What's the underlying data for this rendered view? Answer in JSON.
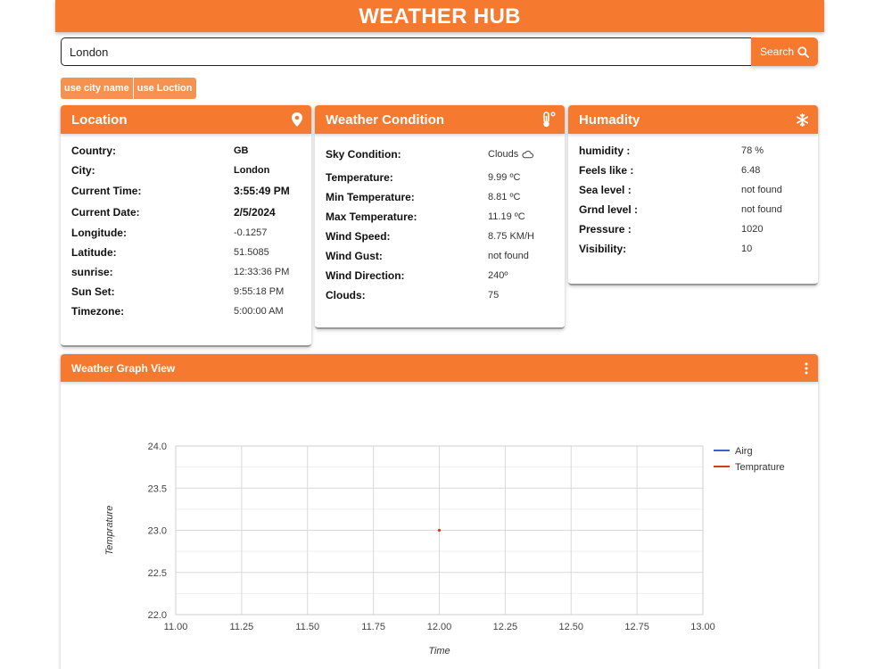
{
  "header": {
    "title": "WEATHER HUB"
  },
  "search": {
    "value": "London",
    "button_label": "Search"
  },
  "toggles": {
    "city_label": "use city name",
    "location_label": "use Loction"
  },
  "location": {
    "title": "Location",
    "rows": [
      {
        "label": "Country:",
        "value": "GB"
      },
      {
        "label": "City:",
        "value": "London"
      },
      {
        "label": "Current Time:",
        "value": "3:55:49 PM"
      },
      {
        "label": "Current Date:",
        "value": "2/5/2024"
      },
      {
        "label": "Longitude:",
        "value": "-0.1257"
      },
      {
        "label": "Latitude:",
        "value": "51.5085"
      },
      {
        "label": "sunrise:",
        "value": "12:33:36 PM"
      },
      {
        "label": "Sun Set:",
        "value": "9:55:18 PM"
      },
      {
        "label": "Timezone:",
        "value": "5:00:00 AM"
      }
    ]
  },
  "weather": {
    "title": "Weather Condition",
    "rows": [
      {
        "label": "Sky Condition:",
        "value": "Clouds"
      },
      {
        "label": "Temperature:",
        "value": "9.99 ºC"
      },
      {
        "label": "Min Temperature:",
        "value": "8.81 ºC"
      },
      {
        "label": "Max Temperature:",
        "value": "11.19 ºC"
      },
      {
        "label": "Wind Speed:",
        "value": "8.75 KM/H"
      },
      {
        "label": "Wind Gust:",
        "value": "not found"
      },
      {
        "label": "Wind Direction:",
        "value": "240º"
      },
      {
        "label": "Clouds:",
        "value": "75"
      }
    ]
  },
  "humidity": {
    "title": "Humadity",
    "rows": [
      {
        "label": "humidity :",
        "value": "78 %"
      },
      {
        "label": "Feels like :",
        "value": "6.48"
      },
      {
        "label": "Sea level :",
        "value": "not found"
      },
      {
        "label": "Grnd level :",
        "value": "not found"
      },
      {
        "label": "Pressure :",
        "value": "1020"
      },
      {
        "label": "Visibility:",
        "value": "10"
      }
    ]
  },
  "graph": {
    "title": "Weather Graph View"
  },
  "icons": {
    "search": "search-icon",
    "location": "map-pin-icon",
    "weather": "thermometer-icon",
    "humidity": "snowflake-icon",
    "sky": "cloud-icon",
    "menu": "more-vertical-icon"
  },
  "colors": {
    "accent": "#f57a30",
    "toggle": "#f5924f",
    "series_airg": "#3366cc",
    "series_temp": "#dc3912"
  },
  "chart_data": {
    "type": "line",
    "xlabel": "Time",
    "ylabel": "Temprature",
    "xlim": [
      11.0,
      13.0
    ],
    "ylim": [
      22.0,
      24.0
    ],
    "x_ticks": [
      "11.00",
      "11.25",
      "11.50",
      "11.75",
      "12.00",
      "12.25",
      "12.50",
      "12.75",
      "13.00"
    ],
    "y_ticks": [
      "22.0",
      "22.5",
      "23.0",
      "23.5",
      "24.0"
    ],
    "grid": true,
    "legend": "right",
    "series": [
      {
        "name": "Airg",
        "color": "#3366cc",
        "points": []
      },
      {
        "name": "Temprature",
        "color": "#dc3912",
        "points": [
          [
            12.0,
            23.0
          ]
        ]
      }
    ]
  }
}
